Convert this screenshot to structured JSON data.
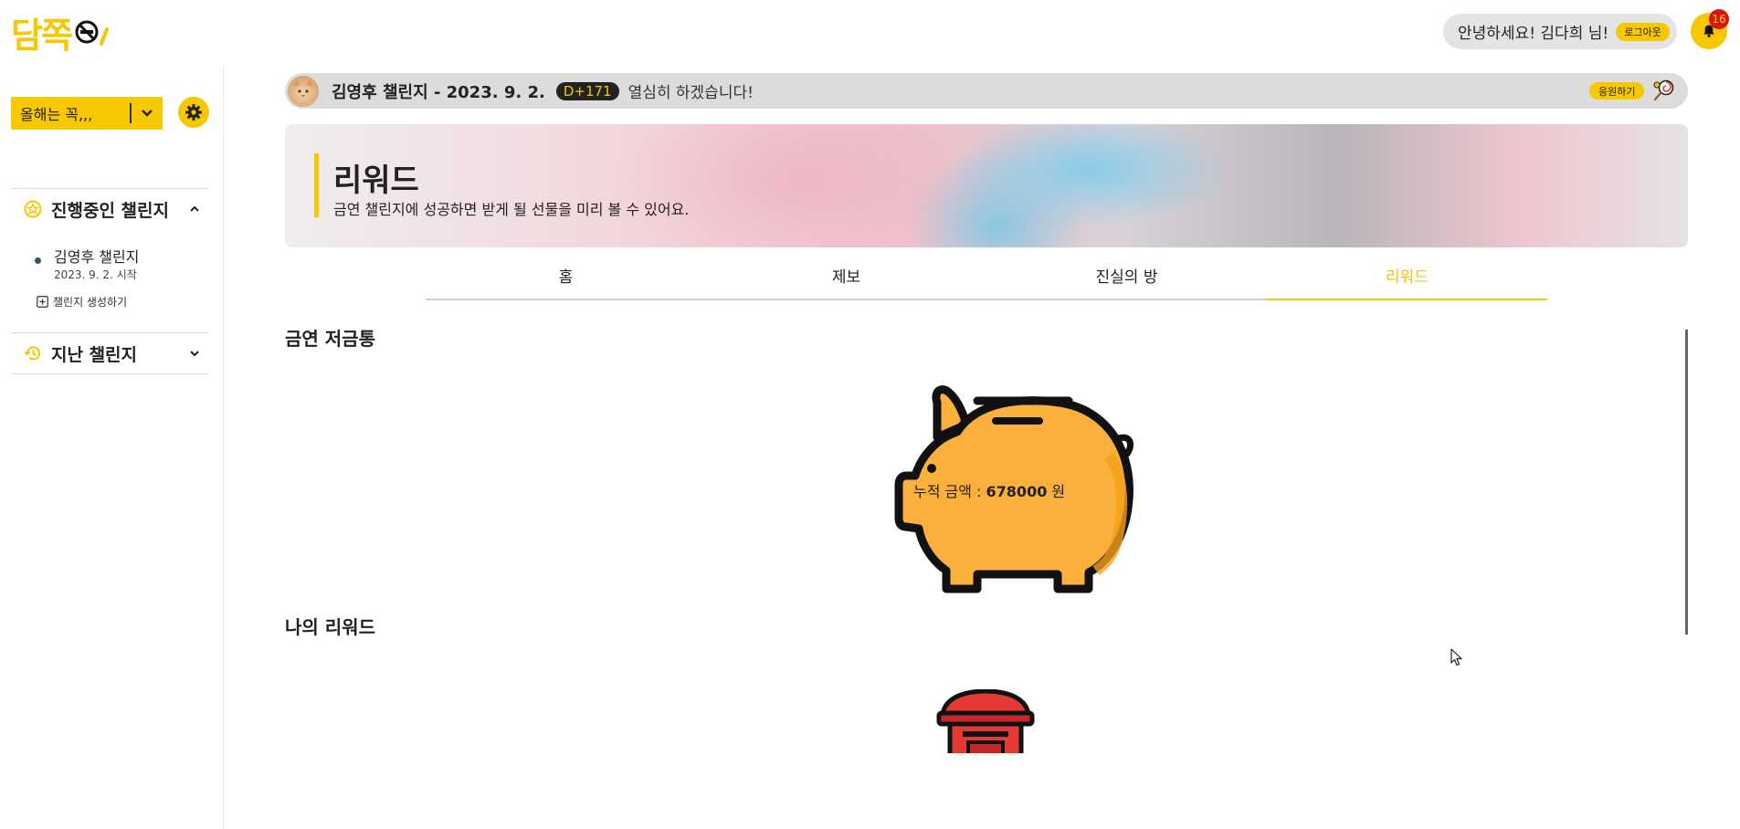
{
  "header": {
    "logo_text": "담쪽",
    "greeting": "안녕하세요! 김다희 님!",
    "logout_label": "로그아웃",
    "notification_count": "16"
  },
  "sidebar": {
    "select_value": "올해는 꼭,,,",
    "sections": [
      {
        "title": "진행중인 챌린지",
        "expanded": true
      },
      {
        "title": "지난 챌린지",
        "expanded": false
      }
    ],
    "challenge": {
      "name": "김영후 챌린지",
      "date": "2023. 9. 2. 시작"
    },
    "create_label": "챌린지 생성하기"
  },
  "challenge_bar": {
    "title": "김영후 챌린지 - 2023. 9. 2.",
    "dday": "D+171",
    "message": "열심히 하겠습니다!",
    "cheer_label": "응원하기"
  },
  "banner": {
    "title": "리워드",
    "subtitle": "금연 챌린지에 성공하면 받게 될 선물을 미리 볼 수 있어요."
  },
  "tabs": [
    {
      "label": "홈",
      "active": false
    },
    {
      "label": "제보",
      "active": false
    },
    {
      "label": "진실의 방",
      "active": false
    },
    {
      "label": "리워드",
      "active": true
    }
  ],
  "savings": {
    "heading": "금연 저금통",
    "amount_prefix": "누적 금액 : ",
    "amount": "678000",
    "amount_unit": " 원"
  },
  "my_rewards": {
    "heading": "나의 리워드"
  },
  "colors": {
    "accent": "#f7c700",
    "pig_body": "#fbb03b",
    "mailbox": "#e53935"
  }
}
